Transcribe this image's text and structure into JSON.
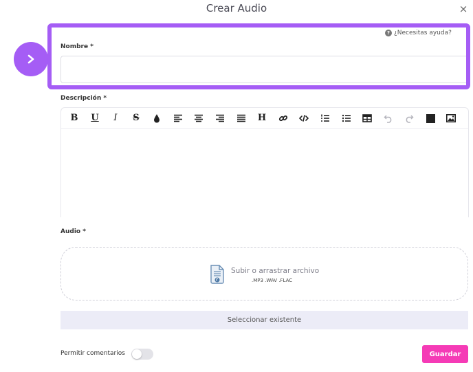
{
  "modal": {
    "title": "Crear Audio",
    "close_label": "×"
  },
  "help": {
    "label": "¿Necesitas ayuda?"
  },
  "name_field": {
    "label": "Nombre *",
    "value": "",
    "placeholder": ""
  },
  "description_field": {
    "label": "Descripción *",
    "toolbar": [
      {
        "name": "bold-button",
        "icon": "bold-icon",
        "text": "B"
      },
      {
        "name": "underline-button",
        "icon": "underline-icon",
        "text": "U"
      },
      {
        "name": "italic-button",
        "icon": "italic-icon",
        "text": "I"
      },
      {
        "name": "strikethrough-button",
        "icon": "strikethrough-icon",
        "text": "S"
      },
      {
        "name": "text-color-button",
        "icon": "droplet-icon"
      },
      {
        "name": "align-left-button",
        "icon": "align-left-icon"
      },
      {
        "name": "align-center-button",
        "icon": "align-center-icon"
      },
      {
        "name": "align-right-button",
        "icon": "align-right-icon"
      },
      {
        "name": "align-justify-button",
        "icon": "align-justify-icon"
      },
      {
        "name": "heading-button",
        "icon": "heading-icon",
        "text": "H"
      },
      {
        "name": "link-button",
        "icon": "link-icon"
      },
      {
        "name": "code-button",
        "icon": "code-icon"
      },
      {
        "name": "ordered-list-button",
        "icon": "ordered-list-icon"
      },
      {
        "name": "bullet-list-button",
        "icon": "bullet-list-icon"
      },
      {
        "name": "table-button",
        "icon": "table-icon"
      },
      {
        "name": "undo-button",
        "icon": "undo-icon"
      },
      {
        "name": "redo-button",
        "icon": "redo-icon"
      },
      {
        "name": "fullscreen-button",
        "icon": "square-icon"
      },
      {
        "name": "image-button",
        "icon": "image-icon"
      }
    ]
  },
  "audio_field": {
    "label": "Audio *",
    "upload_text": "Subir o arrastrar archivo",
    "formats": ".MP3 .WAV .FLAC",
    "select_existing": "Seleccionar existente"
  },
  "comments": {
    "label": "Permitir comentarios",
    "enabled": false
  },
  "save_button": {
    "label": "Guardar"
  },
  "colors": {
    "accent_purple": "#a55df5",
    "save_pink": "#f53bb6",
    "select_bg": "#ececf7"
  }
}
